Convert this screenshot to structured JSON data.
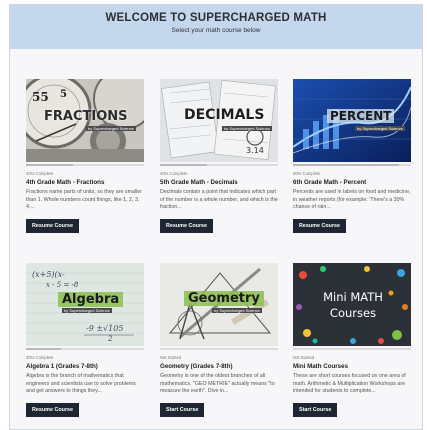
{
  "header": {
    "title": "WELCOME TO SUPERCHARGED MATH",
    "subtitle": "Select your math course below"
  },
  "courses": [
    {
      "thumb_title": "FRACTIONS",
      "thumb_sub": "by Supercharged Science",
      "status": "40% Complete",
      "progress": 0.4,
      "title": "4th Grade Math - Fractions",
      "desc": "Fractions name parts of units, so they are smaller than 1. Whole numbers count things, like 1, 2, 3, 4,...",
      "button": "Resume Course"
    },
    {
      "thumb_title": "DECIMALS",
      "thumb_sub": "by Supercharged Science",
      "status": "40% Complete",
      "progress": 0.4,
      "title": "5th Grade Math - Decimals",
      "desc": "Decimals contain a point that indicates which part of the number is a whole number, and which is the fraction...",
      "button": "Resume Course"
    },
    {
      "thumb_title": "PERCENT",
      "thumb_sub": "by Supercharged Science",
      "status": "90% Complete",
      "progress": 0.9,
      "title": "6th Grade Math - Percent",
      "desc": "Percents are used in labels on food and medicine, in weather reports (for example: 'There's a 30% chance of rain...",
      "button": "Resume Course"
    },
    {
      "thumb_title": "Algebra",
      "thumb_sub": "by Supercharged Science",
      "status": "30% Complete",
      "progress": 0.3,
      "title": "Algebra 1 (Grades 7-8th)",
      "desc": "Algebra is the branch of mathematics that engineers and scientists use to solve problems and get answers to things they...",
      "button": "Resume Course"
    },
    {
      "thumb_title": "Geometry",
      "thumb_sub": "by Supercharged Science",
      "status": "Not Started",
      "progress": 0,
      "title": "Geometry (Grades 7-8th)",
      "desc": "Geometry is one of the oldest branches of all mathematics. \"GEO METRIE\" actually means \"to measure the earth\". Dive in...",
      "button": "Start Course"
    },
    {
      "thumb_title": "Mini MATH Courses",
      "thumb_sub": "",
      "status": "Not Started",
      "progress": 0,
      "title": "Mini Math Courses",
      "desc": "These are short courses focused on one area of math. Arithmetic & Multiplication Workshops are intended for students to complete...",
      "button": "Start Course"
    }
  ],
  "colors": {
    "header_bg": "#c5d7ec",
    "button_bg": "#1e2634",
    "page_bg": "#f7f7f9"
  }
}
